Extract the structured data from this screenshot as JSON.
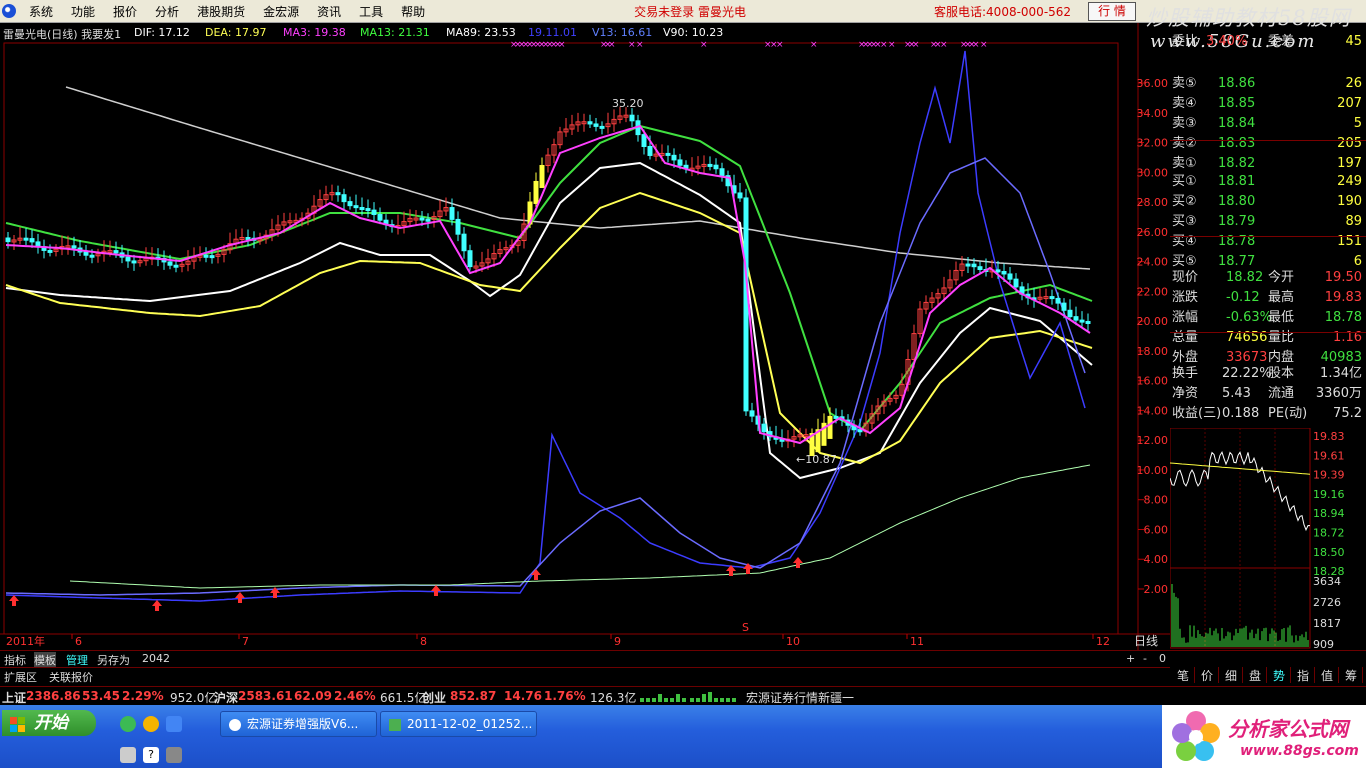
{
  "menu": {
    "items": [
      "系统",
      "功能",
      "报价",
      "分析",
      "港股期货",
      "金宏源",
      "资讯",
      "工具",
      "帮助"
    ],
    "login_status": "交易未登录 雷曼光电",
    "hotline": "客服电话:4008-000-562",
    "trade_button": "行 情"
  },
  "watermark": {
    "line1": "炒股辅助教材58股网",
    "line2": "www.58Gu.com"
  },
  "chart": {
    "title": "雷曼光电(日线) 我要发1",
    "indicators": [
      {
        "label": "DIF: 17.12",
        "color": "#ffffff"
      },
      {
        "label": "DEA: 17.97",
        "color": "#ffff55"
      },
      {
        "label": "MA3: 19.38",
        "color": "#ff40ff"
      },
      {
        "label": "MA13: 21.31",
        "color": "#40ff40"
      },
      {
        "label": "MA89: 23.53",
        "color": "#ffffff"
      },
      {
        "label": "19.11.01",
        "color": "#4040ff"
      },
      {
        "label": "V13: 16.61",
        "color": "#6080ff"
      },
      {
        "label": "V90: 10.23",
        "color": "#ffffff"
      }
    ],
    "high_label": "35.20",
    "low_label": "←10.87",
    "price_axis": [
      "36.00",
      "34.00",
      "32.00",
      "30.00",
      "28.00",
      "26.00",
      "24.00",
      "22.00",
      "20.00",
      "18.00",
      "16.00",
      "14.00",
      "12.00",
      "10.00",
      "8.00",
      "6.00",
      "4.00",
      "2.00"
    ],
    "time_axis": {
      "year": "2011年",
      "months": [
        "6",
        "7",
        "8",
        "9",
        "10",
        "11",
        "12"
      ]
    },
    "marker_s": "S",
    "period": "日线"
  },
  "quote": {
    "header_row": {
      "l1": "委比",
      "v1": "3.40%",
      "l2": "委差",
      "v2": "45"
    },
    "asks": [
      {
        "label": "卖⑤",
        "price": "18.86",
        "vol": "26"
      },
      {
        "label": "卖④",
        "price": "18.85",
        "vol": "207"
      },
      {
        "label": "卖③",
        "price": "18.84",
        "vol": "5"
      },
      {
        "label": "卖②",
        "price": "18.83",
        "vol": "205"
      },
      {
        "label": "卖①",
        "price": "18.82",
        "vol": "197"
      }
    ],
    "bids": [
      {
        "label": "买①",
        "price": "18.81",
        "vol": "249"
      },
      {
        "label": "买②",
        "price": "18.80",
        "vol": "190"
      },
      {
        "label": "买③",
        "price": "18.79",
        "vol": "89"
      },
      {
        "label": "买④",
        "price": "18.78",
        "vol": "151"
      },
      {
        "label": "买⑤",
        "price": "18.77",
        "vol": "6"
      }
    ],
    "stats": [
      {
        "l1": "现价",
        "v1": "18.82",
        "l2": "今开",
        "v2": "19.50"
      },
      {
        "l1": "涨跌",
        "v1": "-0.12",
        "l2": "最高",
        "v2": "19.83"
      },
      {
        "l1": "涨幅",
        "v1": "-0.63%",
        "l2": "最低",
        "v2": "18.78"
      },
      {
        "l1": "总量",
        "v1": "74656",
        "l2": "量比",
        "v2": "1.16"
      },
      {
        "l1": "外盘",
        "v1": "33673",
        "l2": "内盘",
        "v2": "40983"
      }
    ],
    "fundamentals": [
      {
        "l1": "换手",
        "v1": "22.22%",
        "l2": "股本",
        "v2": "1.34亿"
      },
      {
        "l1": "净资",
        "v1": "5.43",
        "l2": "流通",
        "v2": "3360万"
      },
      {
        "l1": "收益(三)",
        "v1": "0.188",
        "l2": "PE(动)",
        "v2": "75.2"
      }
    ]
  },
  "mini_chart": {
    "price_labels": [
      "19.83",
      "19.61",
      "19.39",
      "19.16",
      "18.94",
      "18.72",
      "18.50",
      "18.28"
    ],
    "volume_labels": [
      "3634",
      "2726",
      "1817",
      "909"
    ]
  },
  "tabs": [
    "指标",
    "模板",
    "管理",
    "另存为",
    "2042"
  ],
  "ext_tabs": [
    "扩展区",
    "关联报价"
  ],
  "right_tabs": [
    "笔",
    "价",
    "细",
    "盘",
    "势",
    "指",
    "值",
    "筹"
  ],
  "ctrl_buttons": [
    "+",
    "-",
    "0"
  ],
  "ticker": {
    "sh": {
      "name": "上证",
      "index": "2386.86",
      "chg": "53.45",
      "pct": "2.29%",
      "amt": "952.0亿"
    },
    "sz": {
      "name": "沪深",
      "index": "2583.61",
      "chg": "62.09",
      "pct": "2.46%",
      "amt": "661.5亿"
    },
    "cy": {
      "name": "创业",
      "index": "852.87",
      "chg": "14.76",
      "pct": "1.76%",
      "amt": "126.3亿"
    },
    "news": "宏源证券行情新疆一"
  },
  "taskbar": {
    "start": "开始",
    "tasks": [
      "宏源证券增强版V6...",
      "2011-12-02_01252..."
    ],
    "brand": "分析家公式网",
    "brand_url": "www.88gs.com"
  },
  "colors": {
    "up": "#ff4040",
    "down": "#40ffff",
    "ma3": "#ff40ff",
    "ma13": "#40e040",
    "dif": "#ffffff",
    "dea": "#ffff55"
  }
}
